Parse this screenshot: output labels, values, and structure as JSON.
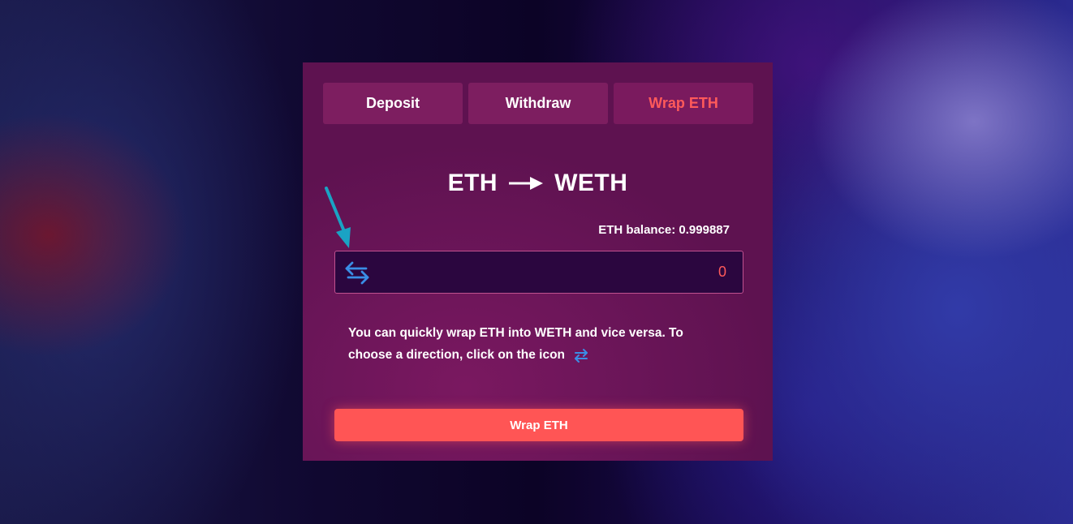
{
  "tabs": [
    {
      "label": "Deposit",
      "active": false
    },
    {
      "label": "Withdraw",
      "active": false
    },
    {
      "label": "Wrap ETH",
      "active": true
    }
  ],
  "header": {
    "from_token": "ETH",
    "to_token": "WETH"
  },
  "balance": {
    "text": "ETH balance: 0.999887"
  },
  "amount_input": {
    "value": "0"
  },
  "description": {
    "text": "You can quickly wrap ETH into WETH and vice versa. To choose a direction, click on the icon"
  },
  "cta": {
    "label": "Wrap ETH"
  },
  "icons": {
    "swap": "swap-arrows-icon",
    "title_arrow": "arrow-right-icon",
    "pointer": "annotation-arrow-icon"
  },
  "colors": {
    "accent": "#ff5555",
    "swap_icon": "#3a8ee6",
    "active_tab": "#ff5a5a",
    "annotation": "#1aa3c4"
  }
}
